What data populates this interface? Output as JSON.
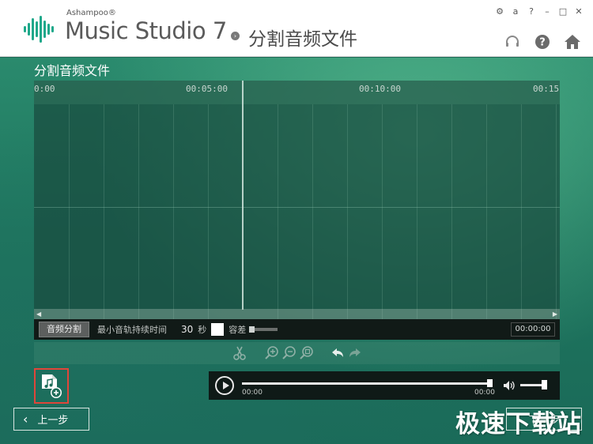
{
  "header": {
    "brand_small": "Ashampoo®",
    "app_name": "Music Studio 7",
    "page_title": "分割音频文件",
    "window_controls": [
      "⚙",
      "a",
      "?",
      "–",
      "□",
      "✕"
    ]
  },
  "main": {
    "section_title": "分割音频文件",
    "timeline": {
      "labels": [
        "0:00",
        "00:05:00",
        "00:10:00",
        "00:15"
      ]
    },
    "split_bar": {
      "split_button": "音频分割",
      "min_duration_label": "最小音轨持续时间",
      "duration_value": "30",
      "duration_unit": "秒",
      "tolerance_label": "容差",
      "time_readout": "00:00:00"
    },
    "player": {
      "time_start": "00:00",
      "time_end": "00:00"
    },
    "back_button": "上一步",
    "next_button": "下一步",
    "watermark": "极速下载站"
  },
  "colors": {
    "accent_green": "#1f765f",
    "header_bg": "#ffffff",
    "add_file_border": "#e0463a"
  },
  "icons": {
    "logo": "waveform-logo-icon",
    "support": "headset-icon",
    "help": "help-circle-icon",
    "home": "home-icon",
    "scissors": "scissors-icon",
    "zoom_in": "zoom-in-icon",
    "zoom_out": "zoom-out-icon",
    "zoom_fit": "zoom-fit-icon",
    "undo": "undo-icon",
    "redo": "redo-icon",
    "add_file": "add-music-file-icon",
    "play": "play-icon",
    "volume": "volume-icon"
  }
}
